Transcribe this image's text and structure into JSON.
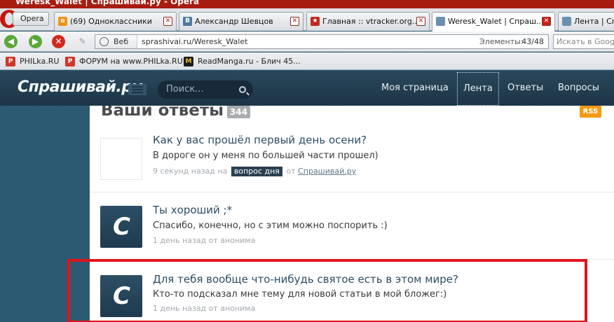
{
  "window": {
    "title": "Weresk_Walet | Спрашивай.ру - Opera"
  },
  "browser": {
    "menu_label": "Opera",
    "tabs": [
      {
        "label": "(69) Одноклассники",
        "icon": "odnoklassniki-icon",
        "color": "#f39314",
        "glyph": "o",
        "active": false
      },
      {
        "label": "Александр Шевцов",
        "icon": "vk-icon",
        "color": "#4d76a1",
        "glyph": "B",
        "active": false
      },
      {
        "label": "Главная :: vtracker.org...",
        "icon": "vtracker-icon",
        "color": "#c0281e",
        "glyph": "★",
        "active": false
      },
      {
        "label": "Weresk_Walet | Спраш...",
        "icon": "page-icon",
        "color": "#6a8fb0",
        "glyph": "",
        "active": true
      },
      {
        "label": "Лента | Спр",
        "icon": "page-icon",
        "color": "#6a8fb0",
        "glyph": "",
        "active": false
      }
    ],
    "address": {
      "web_label": "Веб",
      "url": "sprashivai.ru/Weresk_Walet",
      "elements_label": "Элементы:",
      "elements_count": "43/48"
    },
    "search_placeholder": "Искать в Google",
    "bookmarks": [
      {
        "label": "PHILka.RU",
        "icon": "philka-icon",
        "color": "#d0362b",
        "glyph": "P"
      },
      {
        "label": "ФОРУМ на www.PHILka.RU",
        "icon": "philka-icon",
        "color": "#d0362b",
        "glyph": "P"
      },
      {
        "label": "ReadManga.ru - Блич 45...",
        "icon": "readmanga-icon",
        "color": "#1c1c1c",
        "glyph": "M"
      }
    ]
  },
  "site": {
    "logo": "Спрашивай.ру",
    "search_placeholder": "Поиск...",
    "nav": [
      {
        "label": "Моя страница",
        "active": false
      },
      {
        "label": "Лента",
        "active": true
      },
      {
        "label": "Ответы",
        "active": false
      },
      {
        "label": "Вопросы",
        "active": false
      }
    ]
  },
  "main": {
    "heading": "Ваши ответы",
    "heading_count": "344",
    "rss": "RSS",
    "questions": [
      {
        "question": "Как у вас прошёл первый день осени?",
        "answer": "В дороге он у меня по большей части прошел)",
        "time": "9 секунд назад на",
        "tag": "вопрос дня",
        "from": "от",
        "source": "Спрашивай.ру",
        "avatar": "blank"
      },
      {
        "question": "Ты хороший ;*",
        "answer": "Спасибо, конечно, но с этим можно поспорить :)",
        "time": "1 день назад от анонима",
        "avatar": "logo",
        "avatar_letter": "C"
      },
      {
        "question": "Для тебя вообще что-нибудь святое есть в этом мире?",
        "answer": "Кто-то подсказал мне тему для новой статьи в мой бложег:)",
        "time": "1 день назад от анонима",
        "avatar": "logo",
        "avatar_letter": "C"
      }
    ]
  },
  "colors": {
    "header_bg": "#1d3547",
    "question_link": "#2d4d64",
    "highlight": "#e0141b",
    "rss": "#f29a12"
  }
}
